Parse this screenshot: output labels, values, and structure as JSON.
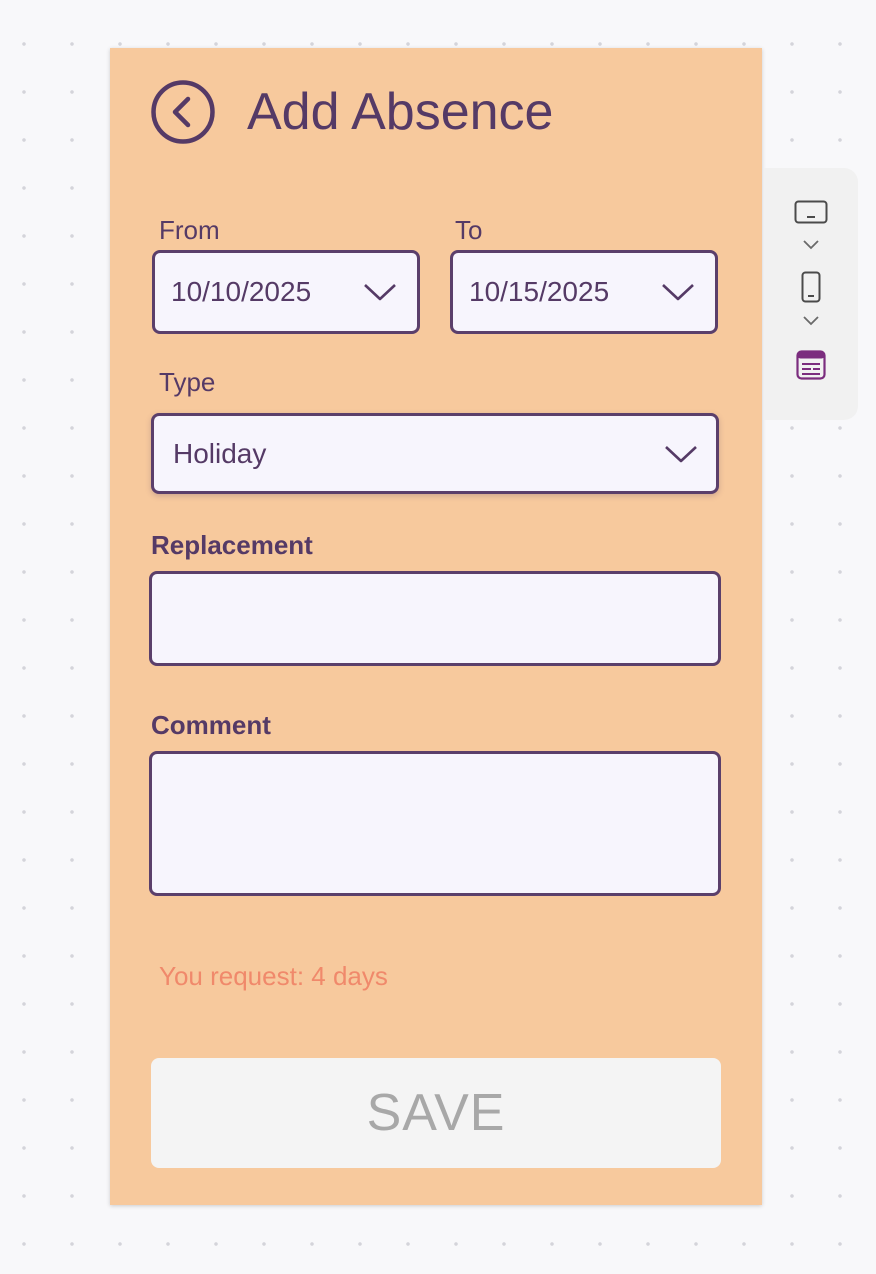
{
  "header": {
    "title": "Add Absence",
    "back_icon": "chevron-left-circle-icon"
  },
  "form": {
    "from": {
      "label": "From",
      "value": "10/10/2025",
      "icon": "chevron-down-icon"
    },
    "to": {
      "label": "To",
      "value": "10/15/2025",
      "icon": "chevron-down-icon"
    },
    "type": {
      "label": "Type",
      "value": "Holiday",
      "icon": "chevron-down-icon"
    },
    "replacement": {
      "label": "Replacement",
      "value": ""
    },
    "comment": {
      "label": "Comment",
      "value": ""
    },
    "request_summary": "You request: 4 days",
    "save_label": "SAVE"
  },
  "side_panel": {
    "icons": [
      "tablet-landscape-icon",
      "chevron-down-icon",
      "phone-portrait-icon",
      "chevron-down-icon",
      "form-layout-icon"
    ]
  },
  "colors": {
    "card_bg": "#f7c99d",
    "accent": "#553a66",
    "field_bg": "#f7f5fd",
    "summary_text": "#f0896b",
    "save_bg": "#f4f4f4",
    "save_text": "#a8a8a8",
    "layout_icon": "#7b2d7e"
  }
}
